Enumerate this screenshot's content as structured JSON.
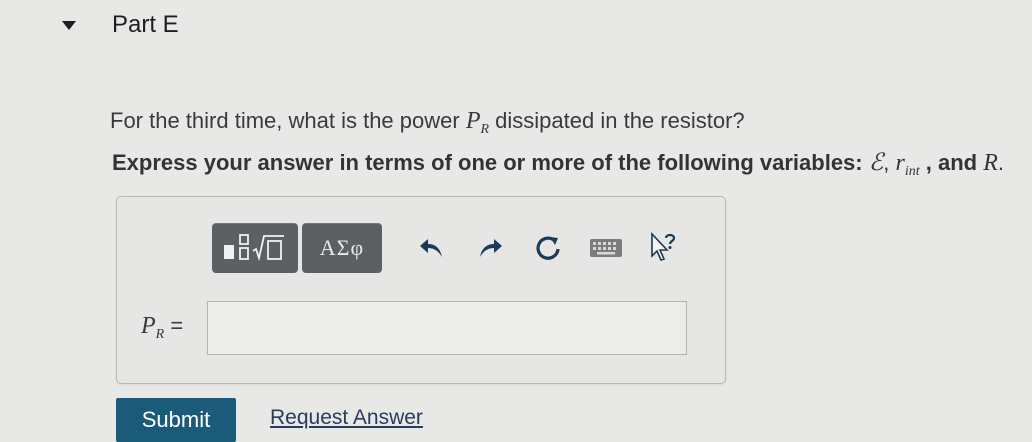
{
  "part": {
    "title": "Part E"
  },
  "question": {
    "prefix": "For the third time, what is the power ",
    "var_main": "P",
    "var_sub": "R",
    "suffix": " dissipated in the resistor?"
  },
  "instruction": {
    "text": "Express your answer in terms of one or more of the following variables: ",
    "var1": "ℰ",
    "sep1": ", ",
    "var2_main": "r",
    "var2_sub": "int",
    "sep2": " , and ",
    "var3": "R",
    "end": "."
  },
  "toolbar": {
    "greek_label": "ΑΣφ",
    "icons": [
      "templates-icon",
      "undo-icon",
      "redo-icon",
      "reset-icon",
      "keyboard-icon",
      "help-icon"
    ]
  },
  "answer": {
    "label_main": "P",
    "label_sub": "R",
    "label_eq": " =",
    "value": ""
  },
  "actions": {
    "submit_label": "Submit",
    "request_label": "Request Answer"
  },
  "colors": {
    "submit": "#1b5b7a",
    "toolbar": "#5d6063",
    "background": "#e8e9e7"
  }
}
